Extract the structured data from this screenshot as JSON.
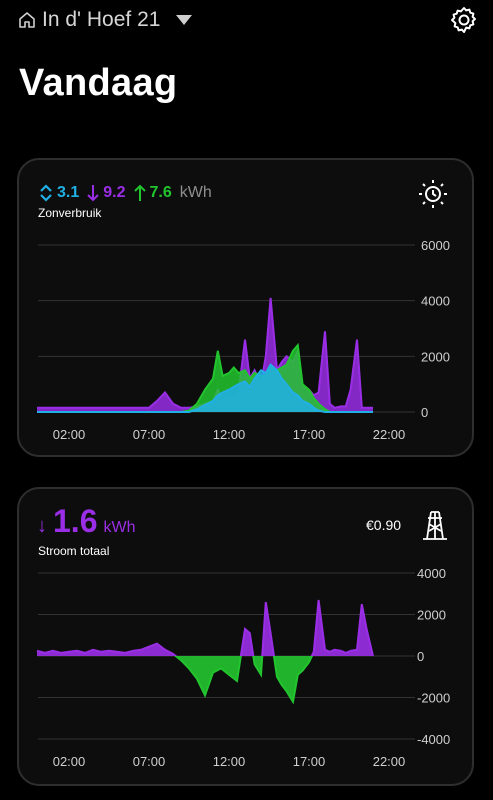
{
  "header": {
    "location": "In d' Hoef 21",
    "icons": {
      "home": "home-icon",
      "dropdown": "chevron-down-icon",
      "settings": "gear-icon"
    }
  },
  "page_title": "Vandaag",
  "card_solar": {
    "stat_self": "3.1",
    "stat_import": "9.2",
    "stat_export": "7.6",
    "unit": "kWh",
    "subtitle": "Zonverbruik",
    "icon": "sun-clock-icon",
    "colors": {
      "self": "#20b0e6",
      "import": "#9a2ee6",
      "export": "#22c52e"
    }
  },
  "card_power": {
    "value": "1.6",
    "unit": "kWh",
    "subtitle": "Stroom totaal",
    "cost": "€0.90",
    "icon": "power-pylon-icon"
  },
  "chart_data": [
    {
      "type": "area",
      "title": "",
      "x_ticks": [
        "02:00",
        "07:00",
        "12:00",
        "17:00",
        "22:00"
      ],
      "y_ticks": [
        "6000",
        "4000",
        "2000",
        "0"
      ],
      "ylim": [
        0,
        6000
      ],
      "grid": true,
      "x": [
        0,
        1,
        2,
        3,
        4,
        5,
        6,
        7,
        7.5,
        8,
        8.5,
        9,
        9.5,
        10,
        10.5,
        11,
        11.3,
        11.6,
        12,
        12.3,
        12.6,
        13,
        13.3,
        13.6,
        14,
        14.3,
        14.6,
        15,
        15.3,
        15.6,
        16,
        16.3,
        16.6,
        17,
        17.3,
        17.6,
        18,
        18.3,
        18.6,
        19,
        19.3,
        19.6,
        20,
        20.3,
        20.6,
        21
      ],
      "series": [
        {
          "name": "",
          "color": "#9a2ee6",
          "values": [
            150,
            150,
            150,
            150,
            150,
            150,
            150,
            150,
            400,
            700,
            300,
            150,
            150,
            200,
            300,
            400,
            800,
            500,
            600,
            400,
            700,
            2600,
            1200,
            1500,
            1000,
            2000,
            4100,
            1500,
            1800,
            2000,
            1800,
            2200,
            900,
            800,
            600,
            700,
            2900,
            300,
            150,
            200,
            200,
            800,
            2600,
            150,
            150,
            150
          ]
        },
        {
          "name": "",
          "color": "#22c52e",
          "values": [
            0,
            0,
            0,
            0,
            0,
            0,
            0,
            0,
            0,
            0,
            0,
            0,
            50,
            300,
            800,
            1200,
            2200,
            1300,
            1400,
            1600,
            1400,
            1500,
            1200,
            1400,
            1300,
            1300,
            1600,
            1500,
            1600,
            1700,
            2200,
            2400,
            1000,
            800,
            500,
            300,
            100,
            0,
            0,
            0,
            0,
            0,
            0,
            0,
            0,
            0
          ]
        },
        {
          "name": "",
          "color": "#20b0e6",
          "values": [
            0,
            0,
            0,
            0,
            0,
            0,
            0,
            0,
            0,
            0,
            0,
            0,
            0,
            100,
            250,
            400,
            600,
            700,
            800,
            900,
            1000,
            1100,
            900,
            1200,
            1500,
            1400,
            1700,
            1500,
            1200,
            1000,
            700,
            600,
            400,
            300,
            150,
            50,
            0,
            0,
            0,
            0,
            0,
            0,
            0,
            0,
            0,
            0
          ]
        }
      ]
    },
    {
      "type": "area",
      "title": "",
      "x_ticks": [
        "02:00",
        "07:00",
        "12:00",
        "17:00",
        "22:00"
      ],
      "y_ticks": [
        "4000",
        "2000",
        "0",
        "-2000",
        "-4000"
      ],
      "ylim": [
        -4000,
        4000
      ],
      "grid": true,
      "x": [
        0,
        0.5,
        1,
        1.5,
        2,
        2.5,
        3,
        3.5,
        4,
        4.5,
        5,
        5.5,
        6,
        6.5,
        7,
        7.5,
        8,
        8.5,
        9,
        9.5,
        10,
        10.5,
        11,
        11.5,
        12,
        12.5,
        13,
        13.3,
        13.6,
        14,
        14.3,
        14.6,
        15,
        15.3,
        15.6,
        16,
        16.3,
        16.6,
        17,
        17.3,
        17.6,
        18,
        18.3,
        18.6,
        19,
        19.3,
        19.6,
        20,
        20.3,
        20.6,
        21
      ],
      "series": [
        {
          "name": "",
          "color": "#9a2ee6",
          "values": [
            250,
            150,
            250,
            150,
            200,
            250,
            150,
            300,
            200,
            250,
            200,
            150,
            250,
            300,
            450,
            600,
            300,
            100,
            -200,
            -600,
            -1100,
            -1900,
            -800,
            -600,
            -900,
            -1200,
            1300,
            1100,
            -400,
            -900,
            2600,
            1100,
            -1000,
            -1400,
            -1700,
            -2200,
            -900,
            -700,
            -300,
            200,
            2700,
            300,
            200,
            300,
            250,
            150,
            250,
            300,
            2500,
            1300,
            0
          ]
        }
      ]
    }
  ]
}
